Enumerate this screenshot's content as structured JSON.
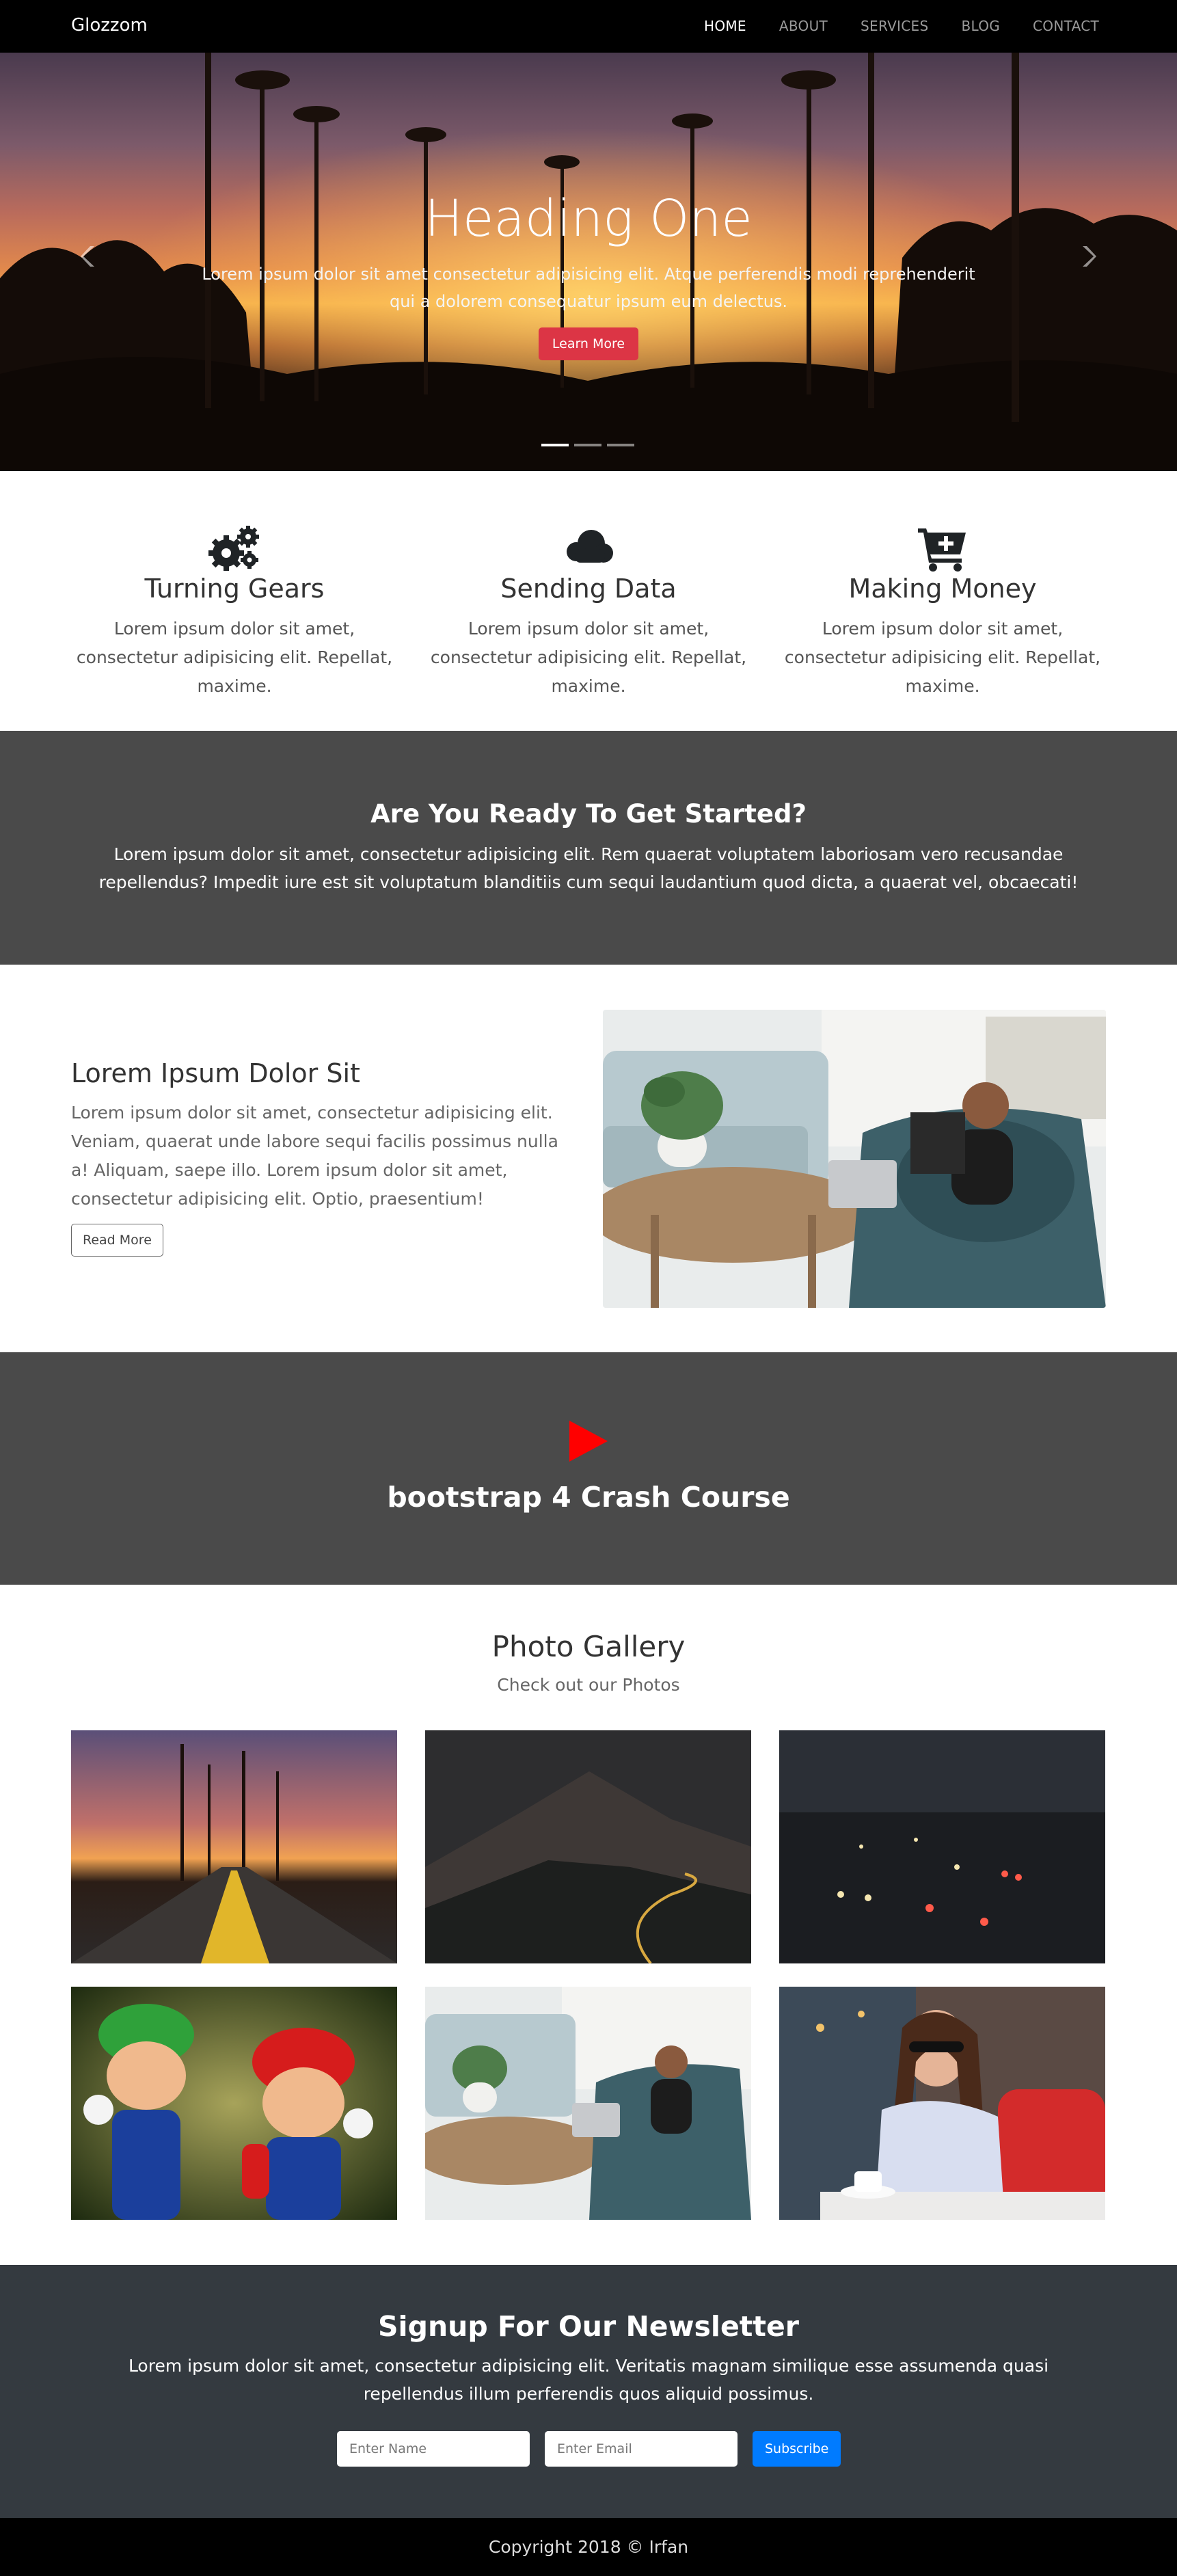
{
  "navbar": {
    "brand": "Glozzom",
    "links": [
      {
        "label": "HOME",
        "active": true
      },
      {
        "label": "ABOUT",
        "active": false
      },
      {
        "label": "SERVICES",
        "active": false
      },
      {
        "label": "BLOG",
        "active": false
      },
      {
        "label": "CONTACT",
        "active": false
      }
    ]
  },
  "hero": {
    "title": "Heading One",
    "text": "Lorem ipsum dolor sit amet consectetur adipisicing elit. Atque perferendis modi reprehenderit qui a dolorem consequatur ipsum eum delectus.",
    "button": "Learn More",
    "prev_icon": "chevron-left-icon",
    "next_icon": "chevron-right-icon",
    "slides": 3,
    "active_slide": 1
  },
  "features": [
    {
      "icon": "gears-icon",
      "title": "Turning Gears",
      "text": "Lorem ipsum dolor sit amet, consectetur adipisicing elit. Repellat, maxime."
    },
    {
      "icon": "cloud-icon",
      "title": "Sending Data",
      "text": "Lorem ipsum dolor sit amet, consectetur adipisicing elit. Repellat, maxime."
    },
    {
      "icon": "cart-plus-icon",
      "title": "Making Money",
      "text": "Lorem ipsum dolor sit amet, consectetur adipisicing elit. Repellat, maxime."
    }
  ],
  "getstarted": {
    "title": "Are You Ready To Get Started?",
    "text": "Lorem ipsum dolor sit amet, consectetur adipisicing elit. Rem quaerat voluptatem laboriosam vero recusandae repellendus? Impedit iure est sit voluptatum blanditiis cum sequi laudantium quod dicta, a quaerat vel, obcaecati!"
  },
  "about": {
    "title": "Lorem Ipsum Dolor Sit",
    "text": "Lorem ipsum dolor sit amet, consectetur adipisicing elit. Veniam, quaerat unde labore sequi facilis possimus nulla a! Aliquam, saepe illo. Lorem ipsum dolor sit amet, consectetur adipisicing elit. Optio, praesentium!",
    "button": "Read More"
  },
  "video": {
    "title": "bootstrap 4 Crash Course",
    "icon": "play-icon"
  },
  "gallery": {
    "title": "Photo Gallery",
    "subtitle": "Check out our Photos"
  },
  "newsletter": {
    "title": "Signup For Our Newsletter",
    "text": "Lorem ipsum dolor sit amet, consectetur adipisicing elit. Veritatis magnam similique esse assumenda quasi repellendus illum perferendis quos aliquid possimus.",
    "name_placeholder": "Enter Name",
    "email_placeholder": "Enter Email",
    "button": "Subscribe"
  },
  "footer": {
    "text": "Copyright 2018 © Irfan"
  },
  "colors": {
    "navbar_bg": "#000000",
    "dark_section_bg": "#4a4a4a",
    "newsletter_bg": "#343a40",
    "learn_button": "#dc3545",
    "subscribe_button": "#007bff",
    "play_icon": "#ff0000"
  }
}
